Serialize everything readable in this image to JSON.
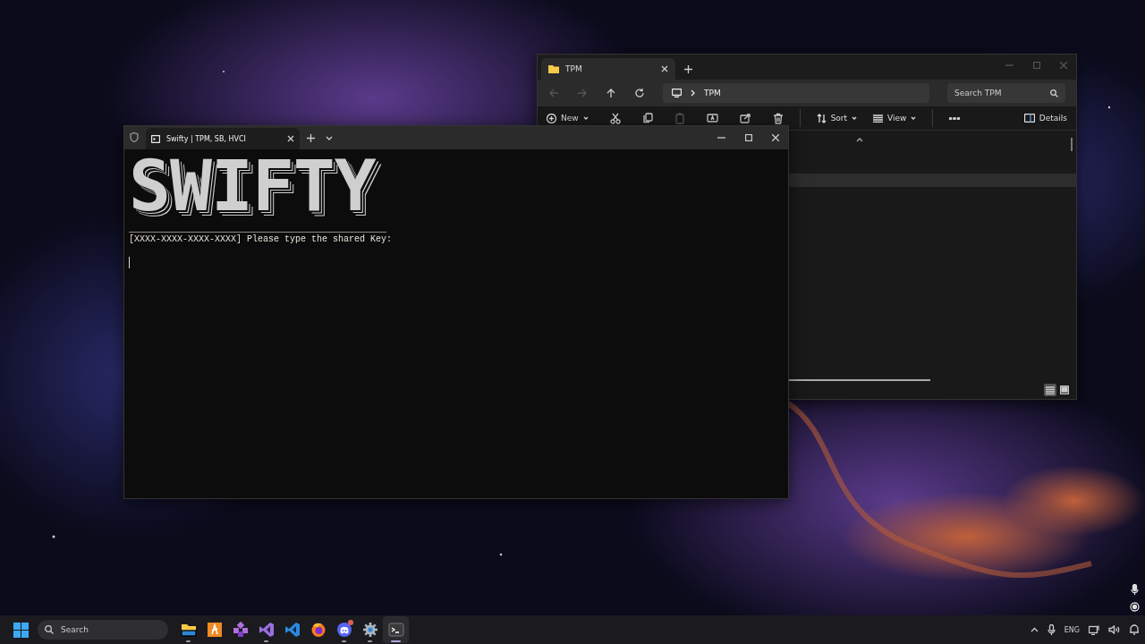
{
  "explorer": {
    "tab_title": "TPM",
    "nav": [
      {
        "kind": "back",
        "disabled": true
      },
      {
        "kind": "forward",
        "disabled": true
      },
      {
        "kind": "up",
        "disabled": false
      },
      {
        "kind": "refresh",
        "disabled": false
      }
    ],
    "breadcrumb": "TPM",
    "search_placeholder": "Search TPM",
    "new_label": "New",
    "actions": [
      {
        "kind": "cut",
        "disabled": false
      },
      {
        "kind": "copy",
        "disabled": false
      },
      {
        "kind": "paste",
        "disabled": true
      },
      {
        "kind": "rename",
        "disabled": false
      },
      {
        "kind": "share",
        "disabled": false
      },
      {
        "kind": "delete",
        "disabled": false
      }
    ],
    "sort_label": "Sort",
    "view_label": "View",
    "details_label": "Details",
    "file_rows": [
      {
        "selected": true
      }
    ],
    "views": [
      {
        "kind": "details",
        "selected": true
      },
      {
        "kind": "tiles",
        "selected": false
      }
    ]
  },
  "terminal": {
    "tab_title": "Swifty | TPM, SB, HVCI",
    "banner": "SWIFTY",
    "rule": "________________________________________________",
    "prompt": "[XXXX-XXXX-XXXX-XXXX] Please type the shared Key:"
  },
  "taskbar": {
    "search_placeholder": "Search",
    "apps": [
      {
        "kind": "explorer",
        "running": true,
        "selected": false,
        "badge": false
      },
      {
        "kind": "sublime",
        "running": false,
        "selected": false,
        "badge": false
      },
      {
        "kind": "squares",
        "running": false,
        "selected": false,
        "badge": false
      },
      {
        "kind": "vs",
        "running": true,
        "selected": false,
        "badge": false
      },
      {
        "kind": "vscode",
        "running": false,
        "selected": false,
        "badge": false
      },
      {
        "kind": "firefox",
        "running": false,
        "selected": false,
        "badge": false
      },
      {
        "kind": "discord",
        "running": true,
        "selected": false,
        "badge": true
      },
      {
        "kind": "settings",
        "running": true,
        "selected": false,
        "badge": false
      },
      {
        "kind": "terminal",
        "running": true,
        "selected": true,
        "badge": false
      }
    ],
    "language": "ENG"
  }
}
